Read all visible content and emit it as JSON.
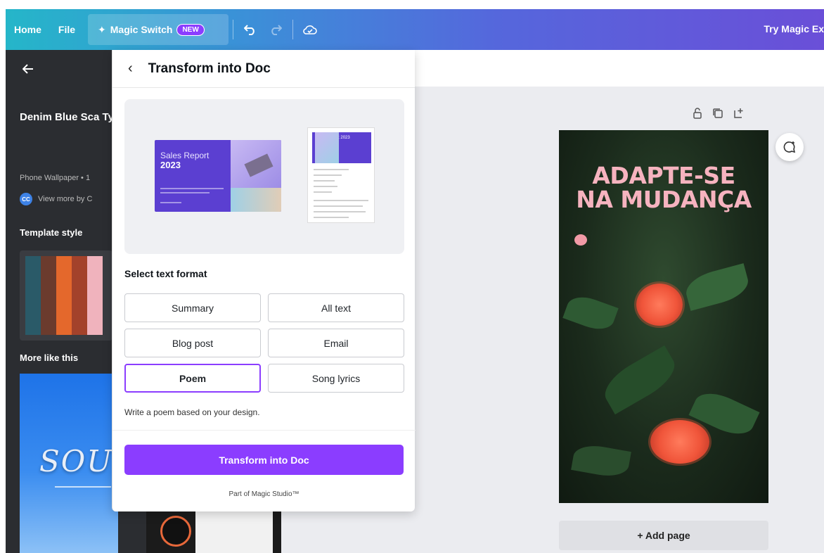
{
  "topbar": {
    "home": "Home",
    "file": "File",
    "magic_switch": "Magic Switch",
    "magic_badge": "NEW",
    "try_magic": "Try Magic Ex"
  },
  "left_panel": {
    "template_title": "Denim Blue Sca Type Anxiety-ca Wallpaper",
    "template_meta": "Phone Wallpaper • 1",
    "author_initials": "CC",
    "author_text": "View more by C",
    "template_style_label": "Template style",
    "more_like_this_label": "More like this",
    "swatch_colors": [
      "#2a5a68",
      "#6b3b2d",
      "#e4682c",
      "#a3422b",
      "#f0b3bd"
    ],
    "thumb_word": "SOU"
  },
  "transform_panel": {
    "title": "Transform into Doc",
    "preview": {
      "slide_title": "Sales Report",
      "slide_year": "2023",
      "doc_title": "Sales Report 2023"
    },
    "select_format_label": "Select text format",
    "formats": [
      {
        "label": "Summary",
        "selected": false
      },
      {
        "label": "All text",
        "selected": false
      },
      {
        "label": "Blog post",
        "selected": false
      },
      {
        "label": "Email",
        "selected": false
      },
      {
        "label": "Poem",
        "selected": true
      },
      {
        "label": "Song lyrics",
        "selected": false
      }
    ],
    "description": "Write a poem based on your design.",
    "cta": "Transform into Doc",
    "footer": "Part of Magic Studio™"
  },
  "canvas": {
    "headline_line1": "ADAPTE-SE",
    "headline_line2": "NA MUDANÇA",
    "add_page": "+ Add page"
  },
  "colors": {
    "accent": "#8b3dff",
    "headline": "#f6b3bf"
  }
}
